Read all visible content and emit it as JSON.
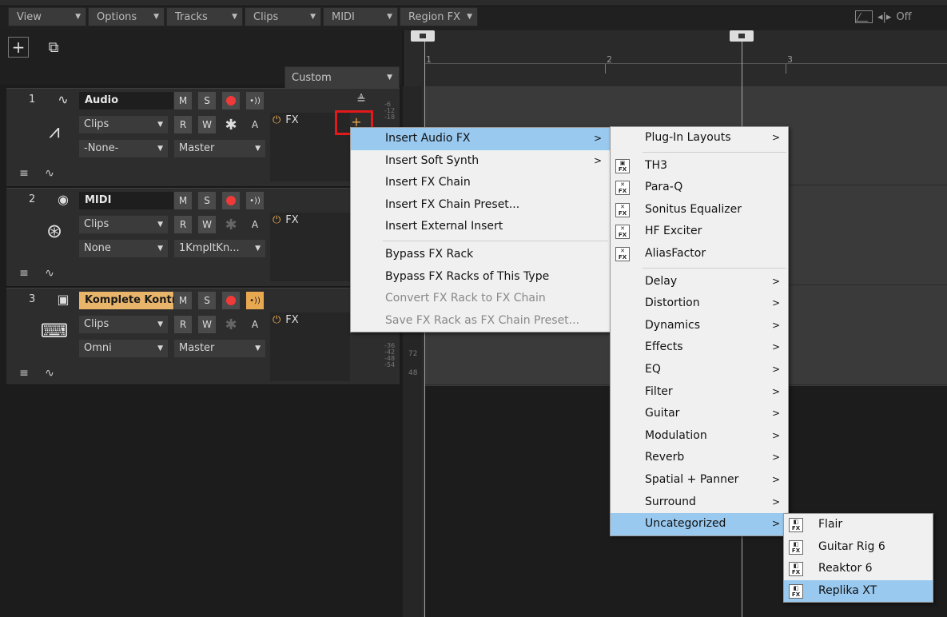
{
  "menubar": {
    "items": [
      {
        "label": "View"
      },
      {
        "label": "Options"
      },
      {
        "label": "Tracks"
      },
      {
        "label": "Clips"
      },
      {
        "label": "MIDI"
      },
      {
        "label": "Region FX"
      }
    ],
    "snap_state": "Off"
  },
  "track_header": {
    "preset_dropdown": "Custom"
  },
  "tracks": [
    {
      "number": "1",
      "name": "Audio",
      "icon": "waveform-icon",
      "input_dropdown": "Clips",
      "channel_dropdown": "-None-",
      "output_dropdown": "Master",
      "fx_label": "FX"
    },
    {
      "number": "2",
      "name": "MIDI",
      "icon": "midi-plug-icon",
      "input_dropdown": "Clips",
      "channel_dropdown": "None",
      "output_dropdown": "1KmpltKn...",
      "fx_label": "FX"
    },
    {
      "number": "3",
      "name": "Komplete Kontrol",
      "icon": "keyboard-icon",
      "input_dropdown": "Clips",
      "channel_dropdown": "Omni",
      "output_dropdown": "Master",
      "fx_label": "FX"
    }
  ],
  "track_buttons": {
    "mute": "M",
    "solo": "S",
    "read": "R",
    "write": "W",
    "auto": "A"
  },
  "meter_scale_top": [
    "-6",
    "-12",
    "-18"
  ],
  "meter_scale_bottom": [
    "-36",
    "-42",
    "-48",
    "-54"
  ],
  "meter_mid": [
    "72",
    "48"
  ],
  "ruler": {
    "bars": [
      "1",
      "2",
      "3"
    ]
  },
  "context_menu": {
    "items": [
      {
        "label": "Insert Audio FX",
        "has_submenu": true,
        "selected": true
      },
      {
        "label": "Insert Soft Synth",
        "has_submenu": true
      },
      {
        "label": "Insert FX Chain"
      },
      {
        "label": "Insert FX Chain Preset..."
      },
      {
        "label": "Insert External Insert"
      },
      {
        "separator": true
      },
      {
        "label": "Bypass FX Rack"
      },
      {
        "label": "Bypass FX Racks of This Type"
      },
      {
        "label": "Convert FX Rack to FX Chain",
        "disabled": true
      },
      {
        "label": "Save FX Rack as FX Chain Preset...",
        "disabled": true
      }
    ]
  },
  "audio_fx_menu": {
    "items": [
      {
        "label": "Plug-In Layouts",
        "has_submenu": true
      },
      {
        "separator": true
      },
      {
        "label": "TH3",
        "icon": "plugin-fx-icon"
      },
      {
        "label": "Para-Q",
        "icon": "plugin-fx-icon"
      },
      {
        "label": "Sonitus Equalizer",
        "icon": "plugin-fx-icon"
      },
      {
        "label": "HF Exciter",
        "icon": "plugin-fx-icon"
      },
      {
        "label": "AliasFactor",
        "icon": "plugin-fx-icon"
      },
      {
        "separator": true
      },
      {
        "label": "Delay",
        "has_submenu": true
      },
      {
        "label": "Distortion",
        "has_submenu": true
      },
      {
        "label": "Dynamics",
        "has_submenu": true
      },
      {
        "label": "Effects",
        "has_submenu": true
      },
      {
        "label": "EQ",
        "has_submenu": true
      },
      {
        "label": "Filter",
        "has_submenu": true
      },
      {
        "label": "Guitar",
        "has_submenu": true
      },
      {
        "label": "Modulation",
        "has_submenu": true
      },
      {
        "label": "Reverb",
        "has_submenu": true
      },
      {
        "label": "Spatial + Panner",
        "has_submenu": true
      },
      {
        "label": "Surround",
        "has_submenu": true
      },
      {
        "label": "Uncategorized",
        "has_submenu": true,
        "selected": true
      }
    ]
  },
  "uncategorized_menu": {
    "items": [
      {
        "label": "Flair",
        "icon": "plugin-fx-icon"
      },
      {
        "label": "Guitar Rig 6",
        "icon": "plugin-fx-icon"
      },
      {
        "label": "Reaktor 6",
        "icon": "plugin-fx-icon"
      },
      {
        "label": "Replika XT",
        "icon": "plugin-fx-icon",
        "selected": true
      }
    ]
  },
  "colors": {
    "menu_highlight": "#99c9ef",
    "record": "#f03a3a",
    "accent_orange": "#e8a850",
    "highlight_box": "#e3191b"
  }
}
